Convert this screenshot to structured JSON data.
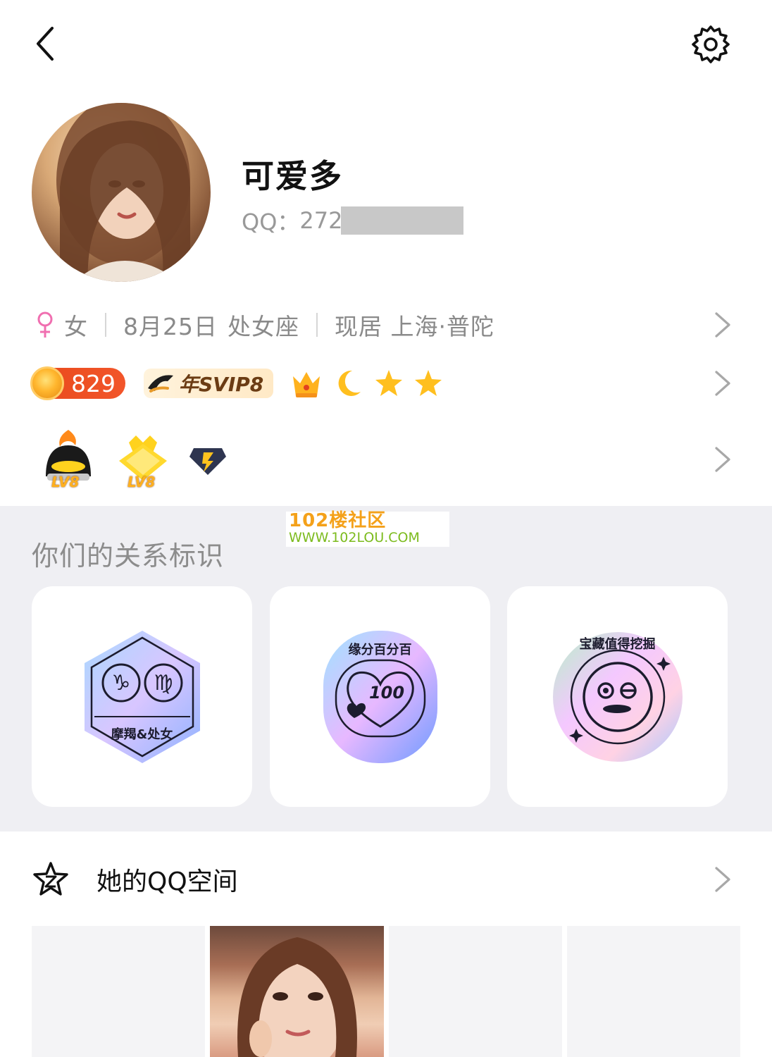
{
  "profile": {
    "nickname": "可爱多",
    "qq_label": "QQ：",
    "qq_visible_digits": "272"
  },
  "info": {
    "gender": "女",
    "birthday": "8月25日",
    "zodiac": "处女座",
    "location": "现居 上海·普陀"
  },
  "vip": {
    "coin_count": "829",
    "svip_label": "年SVIP8"
  },
  "levels": {
    "badge1_level": "LV8",
    "badge2_level": "LV8"
  },
  "watermark": {
    "line1": "102楼社区",
    "line2": "WWW.102LOU.COM"
  },
  "relationship": {
    "title": "你们的关系标识",
    "badges": [
      {
        "label": "摩羯&处女",
        "symbols": "♑ ♍"
      },
      {
        "label": "缘分百分百",
        "number": "100"
      },
      {
        "label": "宝藏值得挖掘"
      }
    ]
  },
  "qzone": {
    "title": "她的QQ空间"
  },
  "colors": {
    "accent_female": "#f06fb0",
    "coin_badge": "#e84a1c",
    "section_bg": "#efeff3"
  }
}
